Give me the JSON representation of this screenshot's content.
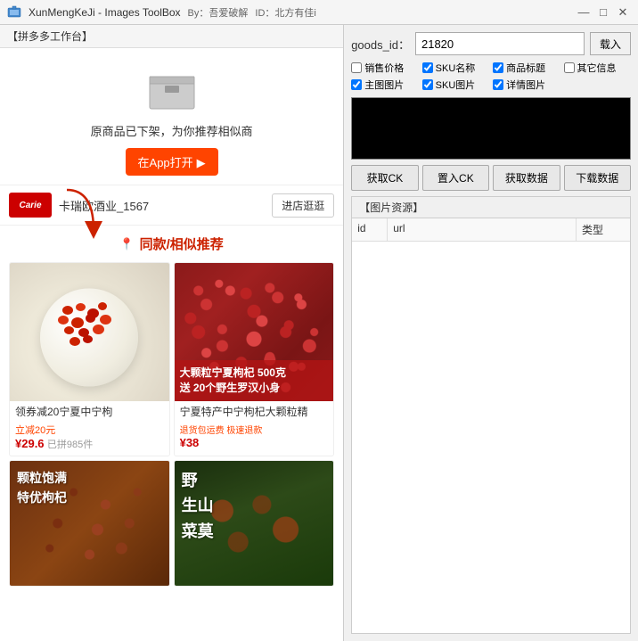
{
  "titleBar": {
    "appName": "XunMengKeJi - Images ToolBox",
    "by": "By：吾爱破解",
    "id": "ID：北方有佳i",
    "minimizeBtn": "—",
    "maximizeBtn": "□",
    "closeBtn": "✕"
  },
  "leftPanel": {
    "header": "【拼多多工作台】",
    "noticeParagraph": "原商品已下架，为你推荐相似商",
    "openAppBtn": "在App打开",
    "storeLogo": "Carie",
    "storeName": "卡瑞欧酒业_1567",
    "visitStoreBtn": "进店逛逛",
    "similarHeader": "同款/相似推荐",
    "products": [
      {
        "title": "领券减20宁夏中宁枸",
        "discount": "立减20元",
        "price": "¥29.6",
        "priceSub": "已拼985件"
      },
      {
        "title": "宁夏特产中宁枸杞大颗粒精",
        "tags": "退货包运费  极速退款",
        "price": "¥38",
        "overlay1": "大颗粒宁夏枸杞 500克",
        "overlay2": "送 20个野生罗汉小身"
      }
    ],
    "bottomProducts": [
      {
        "text1": "颗粒饱满",
        "text2": "特优枸杞"
      },
      {
        "text1": "野",
        "text2": "生山",
        "text3": "菜莫"
      }
    ]
  },
  "rightPanel": {
    "goodsIdLabel": "goods_id：",
    "goodsIdValue": "21820",
    "loadBtn": "载入",
    "checkboxes": [
      {
        "label": "销售价格",
        "checked": false
      },
      {
        "label": "SKU名称",
        "checked": true
      },
      {
        "label": "商品标题",
        "checked": true
      },
      {
        "label": "其它信息",
        "checked": false
      },
      {
        "label": "主图图片",
        "checked": true
      },
      {
        "label": "SKU图片",
        "checked": true
      },
      {
        "label": "详情图片",
        "checked": true
      }
    ],
    "actionButtons": [
      "获取CK",
      "置入CK",
      "获取数据",
      "下载数据"
    ],
    "resourcesHeader": "【图片资源】",
    "tableColumns": [
      "id",
      "url",
      "类型"
    ]
  }
}
